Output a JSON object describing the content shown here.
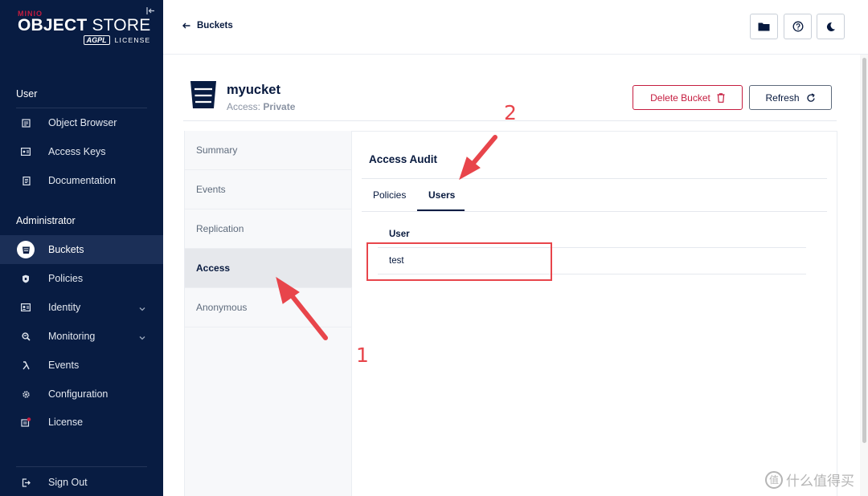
{
  "brand": {
    "minio": "MINIO",
    "title_bold": "OBJECT",
    "title_light": "STORE",
    "agpl": "AGPL",
    "license": "LICENSE"
  },
  "sidebar": {
    "user_section": "User",
    "admin_section": "Administrator",
    "user_items": [
      {
        "label": "Object Browser",
        "icon": "object-browser-icon"
      },
      {
        "label": "Access Keys",
        "icon": "access-keys-icon"
      },
      {
        "label": "Documentation",
        "icon": "documentation-icon"
      }
    ],
    "admin_items": [
      {
        "label": "Buckets",
        "icon": "buckets-icon",
        "active": true
      },
      {
        "label": "Policies",
        "icon": "policies-icon"
      },
      {
        "label": "Identity",
        "icon": "identity-icon",
        "expandable": true
      },
      {
        "label": "Monitoring",
        "icon": "monitoring-icon",
        "expandable": true
      },
      {
        "label": "Events",
        "icon": "lambda-icon"
      },
      {
        "label": "Configuration",
        "icon": "gear-icon"
      },
      {
        "label": "License",
        "icon": "license-icon"
      }
    ],
    "sign_out": "Sign Out"
  },
  "topbar": {
    "back_label": "Buckets",
    "buttons": [
      "folder-icon",
      "help-icon",
      "dark-mode-icon"
    ]
  },
  "bucket": {
    "name": "myucket",
    "access_label": "Access:",
    "access_value": "Private",
    "delete_label": "Delete Bucket",
    "refresh_label": "Refresh"
  },
  "left_nav": [
    "Summary",
    "Events",
    "Replication",
    "Access",
    "Anonymous"
  ],
  "left_nav_active": "Access",
  "content": {
    "title": "Access Audit",
    "tabs": [
      "Policies",
      "Users"
    ],
    "active_tab": "Users",
    "table": {
      "columns": [
        "User"
      ],
      "rows": [
        [
          "test"
        ]
      ]
    }
  },
  "annotations": {
    "num1": "1",
    "num2": "2"
  },
  "watermark": {
    "symbol": "值",
    "text": "什么值得买"
  },
  "colors": {
    "sidebar_bg": "#081c42",
    "accent_red": "#c51c3f",
    "annotation_red": "#e8454b"
  }
}
